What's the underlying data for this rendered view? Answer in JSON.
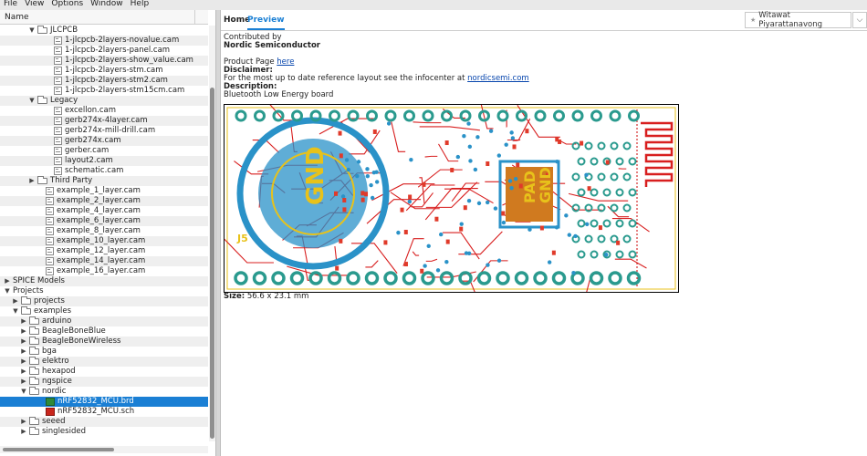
{
  "menu": [
    "File",
    "View",
    "Options",
    "Window",
    "Help"
  ],
  "tree_header": "Name",
  "tree": [
    {
      "indent": 3,
      "toggle": "▼",
      "icon": "folder",
      "label": "JLCPCB"
    },
    {
      "indent": 5,
      "toggle": "",
      "icon": "file",
      "label": "1-jlcpcb-2layers-novalue.cam"
    },
    {
      "indent": 5,
      "toggle": "",
      "icon": "file",
      "label": "1-jlcpcb-2layers-panel.cam"
    },
    {
      "indent": 5,
      "toggle": "",
      "icon": "file",
      "label": "1-jlcpcb-2layers-show_value.cam"
    },
    {
      "indent": 5,
      "toggle": "",
      "icon": "file",
      "label": "1-jlcpcb-2layers-stm.cam"
    },
    {
      "indent": 5,
      "toggle": "",
      "icon": "file",
      "label": "1-jlcpcb-2layers-stm2.cam"
    },
    {
      "indent": 5,
      "toggle": "",
      "icon": "file",
      "label": "1-jlcpcb-2layers-stm15cm.cam"
    },
    {
      "indent": 3,
      "toggle": "▼",
      "icon": "folder",
      "label": "Legacy"
    },
    {
      "indent": 5,
      "toggle": "",
      "icon": "file",
      "label": "excellon.cam"
    },
    {
      "indent": 5,
      "toggle": "",
      "icon": "file",
      "label": "gerb274x-4layer.cam"
    },
    {
      "indent": 5,
      "toggle": "",
      "icon": "file",
      "label": "gerb274x-mill-drill.cam"
    },
    {
      "indent": 5,
      "toggle": "",
      "icon": "file",
      "label": "gerb274x.cam"
    },
    {
      "indent": 5,
      "toggle": "",
      "icon": "file",
      "label": "gerber.cam"
    },
    {
      "indent": 5,
      "toggle": "",
      "icon": "file",
      "label": "layout2.cam"
    },
    {
      "indent": 5,
      "toggle": "",
      "icon": "file",
      "label": "schematic.cam"
    },
    {
      "indent": 3,
      "toggle": "▶",
      "icon": "folder",
      "label": "Third Party"
    },
    {
      "indent": 4,
      "toggle": "",
      "icon": "file",
      "label": "example_1_layer.cam"
    },
    {
      "indent": 4,
      "toggle": "",
      "icon": "file",
      "label": "example_2_layer.cam"
    },
    {
      "indent": 4,
      "toggle": "",
      "icon": "file",
      "label": "example_4_layer.cam"
    },
    {
      "indent": 4,
      "toggle": "",
      "icon": "file",
      "label": "example_6_layer.cam"
    },
    {
      "indent": 4,
      "toggle": "",
      "icon": "file",
      "label": "example_8_layer.cam"
    },
    {
      "indent": 4,
      "toggle": "",
      "icon": "file",
      "label": "example_10_layer.cam"
    },
    {
      "indent": 4,
      "toggle": "",
      "icon": "file",
      "label": "example_12_layer.cam"
    },
    {
      "indent": 4,
      "toggle": "",
      "icon": "file",
      "label": "example_14_layer.cam"
    },
    {
      "indent": 4,
      "toggle": "",
      "icon": "file",
      "label": "example_16_layer.cam"
    },
    {
      "indent": 0,
      "toggle": "▶",
      "icon": "",
      "label": "SPICE Models"
    },
    {
      "indent": 0,
      "toggle": "▼",
      "icon": "",
      "label": "Projects"
    },
    {
      "indent": 1,
      "toggle": "▶",
      "icon": "folder",
      "label": "projects"
    },
    {
      "indent": 1,
      "toggle": "▼",
      "icon": "folder",
      "label": "examples"
    },
    {
      "indent": 2,
      "toggle": "▶",
      "icon": "folder",
      "label": "arduino"
    },
    {
      "indent": 2,
      "toggle": "▶",
      "icon": "folder",
      "label": "BeagleBoneBlue"
    },
    {
      "indent": 2,
      "toggle": "▶",
      "icon": "folder",
      "label": "BeagleBoneWireless"
    },
    {
      "indent": 2,
      "toggle": "▶",
      "icon": "folder",
      "label": "bga"
    },
    {
      "indent": 2,
      "toggle": "▶",
      "icon": "folder",
      "label": "elektro"
    },
    {
      "indent": 2,
      "toggle": "▶",
      "icon": "folder",
      "label": "hexapod"
    },
    {
      "indent": 2,
      "toggle": "▶",
      "icon": "folder",
      "label": "ngspice"
    },
    {
      "indent": 2,
      "toggle": "▼",
      "icon": "folder",
      "label": "nordic"
    },
    {
      "indent": 4,
      "toggle": "",
      "icon": "brd",
      "label": "nRF52832_MCU.brd",
      "selected": true
    },
    {
      "indent": 4,
      "toggle": "",
      "icon": "sch",
      "label": "nRF52832_MCU.sch"
    },
    {
      "indent": 2,
      "toggle": "▶",
      "icon": "folder",
      "label": "seeed"
    },
    {
      "indent": 2,
      "toggle": "▶",
      "icon": "folder",
      "label": "singlesided"
    }
  ],
  "tabs": {
    "home": "Home",
    "preview": "Preview"
  },
  "user": {
    "name": "Witawat Piyarattanavong",
    "dropdown_icon": "chevron-down-icon"
  },
  "preview": {
    "contributed_by": "Contributed by",
    "author": "Nordic Semiconductor",
    "product_page_label": "Product Page",
    "product_page_link": "here",
    "disclaimer_label": "Disclaimer:",
    "disclaimer_text": "For the most up to date reference layout see the infocenter at",
    "disclaimer_link": "nordicsemi.com",
    "description_label": "Description:",
    "description_text": "Bluetooth Low Energy board",
    "size_label": "Size:",
    "size_value": "56.6 x 23.1 mm",
    "board_labels": {
      "gnd1": "GND",
      "pad": "PAD",
      "gnd2": "GND",
      "j5": "J5"
    }
  },
  "colors": {
    "selection": "#1a7fd4",
    "pcb_copper": "#d81f1f",
    "pcb_pad": "#2a9a8e",
    "pcb_via": "#2a92c8",
    "pcb_silk": "#e8c21a"
  }
}
